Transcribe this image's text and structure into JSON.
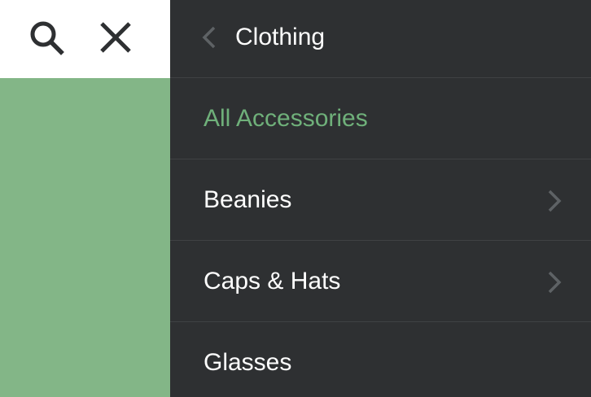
{
  "colors": {
    "accent_green": "#83b687",
    "menu_bg": "#2e3032",
    "divider": "#3f4244",
    "active_text": "#6fb07a",
    "text": "#ffffff",
    "chevron": "#5e6265",
    "icon_dark": "#2e3032"
  },
  "toolbar": {
    "search_icon": "search-icon",
    "close_icon": "close-icon"
  },
  "menu": {
    "back_icon": "chevron-left-icon",
    "title": "Clothing",
    "items": [
      {
        "label": "All Accessories",
        "active": true,
        "has_children": false
      },
      {
        "label": "Beanies",
        "active": false,
        "has_children": true
      },
      {
        "label": "Caps & Hats",
        "active": false,
        "has_children": true
      },
      {
        "label": "Glasses",
        "active": false,
        "has_children": false
      }
    ]
  }
}
